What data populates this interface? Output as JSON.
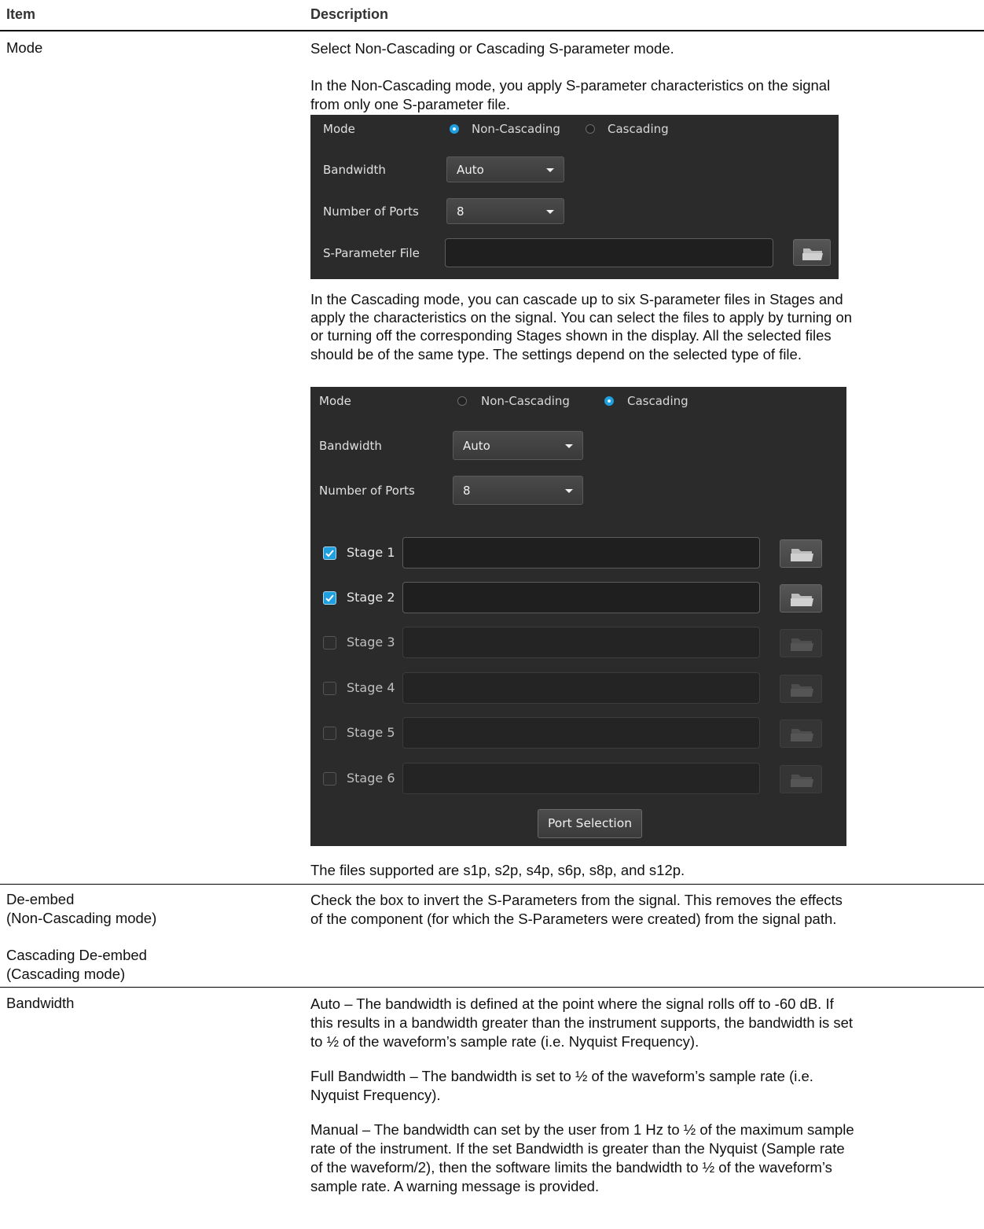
{
  "table": {
    "header_item": "Item",
    "header_description": "Description"
  },
  "rows": {
    "mode": {
      "item": "Mode",
      "p1": "Select Non-Cascading or Cascading S-parameter mode.",
      "p2_line1": "In the Non-Cascading mode, you apply S-parameter characteristics on the signal",
      "p2_line2": "from only one S-parameter file.",
      "p3_lines": [
        "In the Cascading mode, you can cascade up to six S-parameter files in Stages and",
        "apply the characteristics on the signal. You can select the files to apply by turning on",
        "or turning off the corresponding Stages shown in the display.  All the selected files",
        "should be of the same type. The settings depend on the selected type of file."
      ],
      "p4": "The files supported are s1p, s2p, s4p, s6p, s8p, and s12p."
    },
    "deembed": {
      "item_line1": "De-embed",
      "item_line2": "(Non-Cascading mode)",
      "item_line3": "Cascading De-embed",
      "item_line4": "(Cascading mode)",
      "desc_line1": "Check the box to invert the S-Parameters from the signal. This removes the effects",
      "desc_line2": "of the component (for which the S-Parameters were created) from the signal path."
    },
    "bandwidth": {
      "item": "Bandwidth",
      "auto_lines": [
        "Auto – The bandwidth is defined at the point where the signal rolls off to -60 dB. If",
        "this results in a bandwidth greater than the instrument supports, the bandwidth is set",
        "to ½ of the waveform’s sample rate (i.e. Nyquist Frequency)."
      ],
      "full_lines": [
        "Full Bandwidth – The bandwidth is set to ½ of the waveform’s sample rate (i.e.",
        "Nyquist Frequency)."
      ],
      "manual_lines": [
        "Manual – The bandwidth can set by the user from 1 Hz to ½ of the maximum sample",
        "rate of the instrument. If the set Bandwidth is greater than the Nyquist (Sample rate",
        "of the waveform/2), then the software limits the bandwidth to ½ of the waveform’s",
        "sample rate. A warning message is provided."
      ]
    }
  },
  "panel_noncascading": {
    "mode_label": "Mode",
    "opt_noncascading": "Non-Cascading",
    "opt_cascading": "Cascading",
    "selected": "Non-Cascading",
    "bandwidth_label": "Bandwidth",
    "bandwidth_value": "Auto",
    "ports_label": "Number of Ports",
    "ports_value": "8",
    "file_label": "S-Parameter File",
    "file_value": ""
  },
  "panel_cascading": {
    "mode_label": "Mode",
    "opt_noncascading": "Non-Cascading",
    "opt_cascading": "Cascading",
    "selected": "Cascading",
    "bandwidth_label": "Bandwidth",
    "bandwidth_value": "Auto",
    "ports_label": "Number of Ports",
    "ports_value": "8",
    "stages": [
      {
        "label": "Stage 1",
        "checked": true,
        "value": ""
      },
      {
        "label": "Stage 2",
        "checked": true,
        "value": ""
      },
      {
        "label": "Stage 3",
        "checked": false,
        "value": ""
      },
      {
        "label": "Stage 4",
        "checked": false,
        "value": ""
      },
      {
        "label": "Stage 5",
        "checked": false,
        "value": ""
      },
      {
        "label": "Stage 6",
        "checked": false,
        "value": ""
      }
    ],
    "port_selection_label": "Port Selection"
  },
  "colors": {
    "panel_bg": "#2b2b2b",
    "accent": "#1e9fe0"
  }
}
